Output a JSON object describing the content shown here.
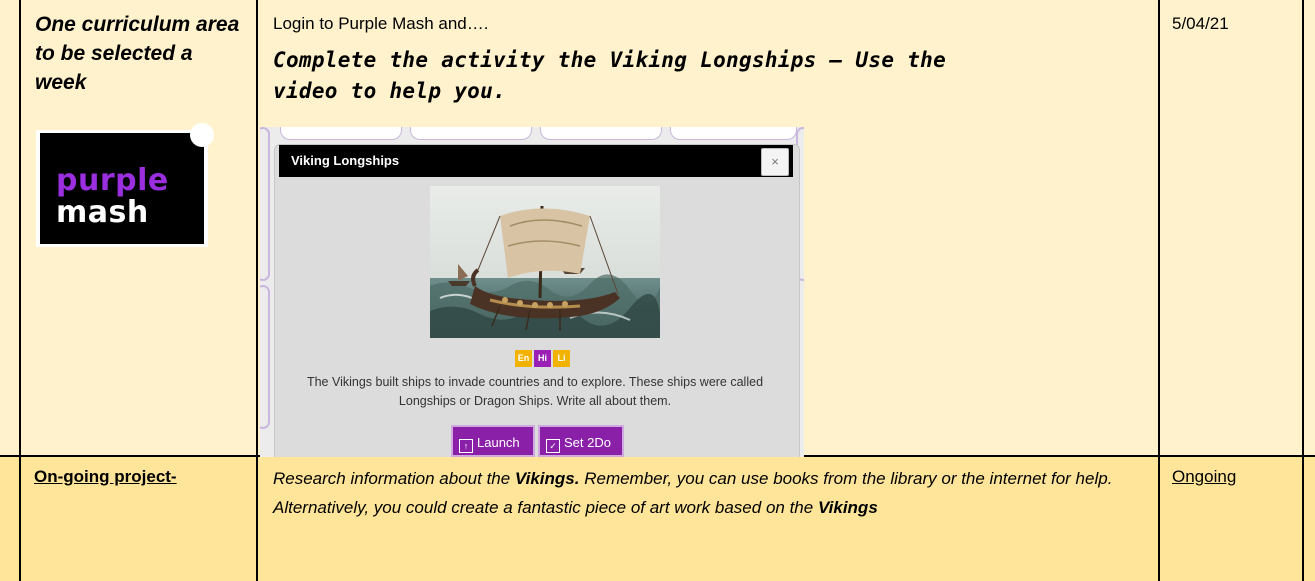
{
  "row1": {
    "col1_title": "One curriculum area to be selected a week",
    "logo": {
      "word1": "purple",
      "word2": "mash"
    },
    "instruction": "Login to Purple Mash and….",
    "task": "Complete the activity the Viking Longships – Use the video to help you.",
    "date": "5/04/21"
  },
  "activity": {
    "title": "Viking Longships",
    "close": "×",
    "tags": [
      {
        "label": "En",
        "color": "#f2b200"
      },
      {
        "label": "Hi",
        "color": "#9a1fb5"
      },
      {
        "label": "Li",
        "color": "#f2b200"
      }
    ],
    "description": "The Vikings built ships to invade countries and to explore. These ships were called Longships or Dragon Ships. Write all about them.",
    "launch_label": "Launch",
    "set2do_label": "Set 2Do"
  },
  "row2": {
    "col1": "On-going project-",
    "text_a": "Research information about the ",
    "bold1": "Vikings.",
    "text_b": " Remember, you can use books from the library or the internet for help. Alternatively, you could create a fantastic piece of art work based on the ",
    "bold2": "Vikings",
    "col3": "Ongoing"
  },
  "colors": {
    "row1_bg": "#fff2cc",
    "row2_bg": "#ffe599",
    "purple": "#8a1fa8"
  }
}
